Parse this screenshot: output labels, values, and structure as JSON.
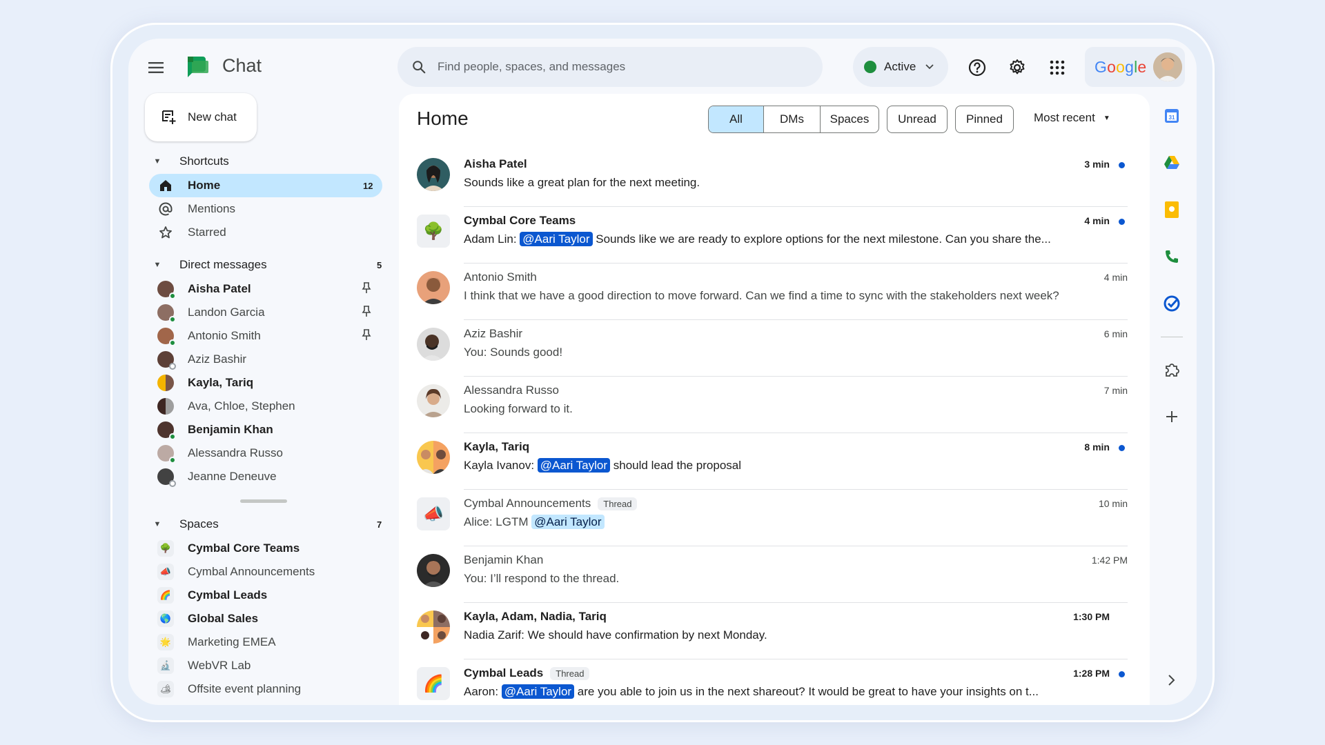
{
  "app": {
    "title": "Chat",
    "brand": "Google"
  },
  "search": {
    "placeholder": "Find people, spaces, and messages"
  },
  "status": {
    "label": "Active",
    "color": "#1e8e3e"
  },
  "sidebar": {
    "new_chat": "New chat",
    "shortcuts": {
      "header": "Shortcuts",
      "items": [
        {
          "label": "Home",
          "badge": "12",
          "icon": "home-icon",
          "selected": true
        },
        {
          "label": "Mentions",
          "icon": "at-icon"
        },
        {
          "label": "Starred",
          "icon": "star-icon"
        }
      ]
    },
    "direct_messages": {
      "header": "Direct messages",
      "count": "5",
      "items": [
        {
          "label": "Aisha Patel",
          "unread": true,
          "pinned": true
        },
        {
          "label": "Landon Garcia",
          "pinned": true
        },
        {
          "label": "Antonio Smith",
          "pinned": true
        },
        {
          "label": "Aziz Bashir"
        },
        {
          "label": "Kayla, Tariq",
          "unread": true
        },
        {
          "label": "Ava, Chloe, Stephen"
        },
        {
          "label": "Benjamin Khan",
          "unread": true
        },
        {
          "label": "Alessandra Russo"
        },
        {
          "label": "Jeanne Deneuve"
        }
      ]
    },
    "spaces": {
      "header": "Spaces",
      "count": "7",
      "items": [
        {
          "label": "Cymbal Core Teams",
          "unread": true,
          "emoji": "🌳"
        },
        {
          "label": "Cymbal Announcements",
          "emoji": "📣"
        },
        {
          "label": "Cymbal Leads",
          "unread": true,
          "emoji": "🌈"
        },
        {
          "label": "Global Sales",
          "unread": true,
          "emoji": "🌎"
        },
        {
          "label": "Marketing EMEA",
          "emoji": "🌟"
        },
        {
          "label": "WebVR Lab",
          "emoji": "🔬"
        },
        {
          "label": "Offsite event planning",
          "emoji": "🏕"
        }
      ]
    }
  },
  "main": {
    "title": "Home",
    "filters": {
      "segmented": [
        "All",
        "DMs",
        "Spaces"
      ],
      "chips": [
        "Unread",
        "Pinned"
      ],
      "sort": "Most recent"
    },
    "conversations": [
      {
        "name": "Aisha Patel",
        "time": "3 min",
        "unread": true,
        "text": "Sounds like a great plan for the next meeting."
      },
      {
        "name": "Cymbal Core Teams",
        "time": "4 min",
        "unread": true,
        "prefix": "Adam Lin: ",
        "mention": "@Aari Taylor",
        "text": " Sounds like we are ready to explore options for the next milestone. Can you share the..."
      },
      {
        "name": "Antonio Smith",
        "time": "4 min",
        "text": "I think that we have a good direction to move forward. Can we find a time to sync with the stakeholders next week?"
      },
      {
        "name": "Aziz Bashir",
        "time": "6 min",
        "text": "You: Sounds good!"
      },
      {
        "name": "Alessandra Russo",
        "time": "7 min",
        "text": "Looking forward to it."
      },
      {
        "name": "Kayla, Tariq",
        "time": "8 min",
        "unread": true,
        "prefix": "Kayla Ivanov: ",
        "mention": "@Aari Taylor",
        "text": " should lead the proposal"
      },
      {
        "name": "Cymbal Announcements",
        "tag": "Thread",
        "time": "10 min",
        "prefix": "Alice: LGTM ",
        "mention": "@Aari Taylor",
        "text": ""
      },
      {
        "name": "Benjamin Khan",
        "time": "1:42 PM",
        "text": "You: I’ll respond to the thread."
      },
      {
        "name": "Kayla, Adam, Nadia, Tariq",
        "time": "1:30 PM",
        "unread": true,
        "text": "Nadia Zarif: We should have confirmation by next Monday."
      },
      {
        "name": "Cymbal Leads",
        "tag": "Thread",
        "time": "1:28 PM",
        "unread": true,
        "prefix": "Aaron: ",
        "mention": "@Aari Taylor",
        "text": " are you able to join us in the next shareout? It would be great to have your insights on t..."
      }
    ]
  },
  "colors": {
    "selected": "#c2e7ff",
    "accent": "#0b57d0",
    "page_bg": "#f6f8fc"
  }
}
